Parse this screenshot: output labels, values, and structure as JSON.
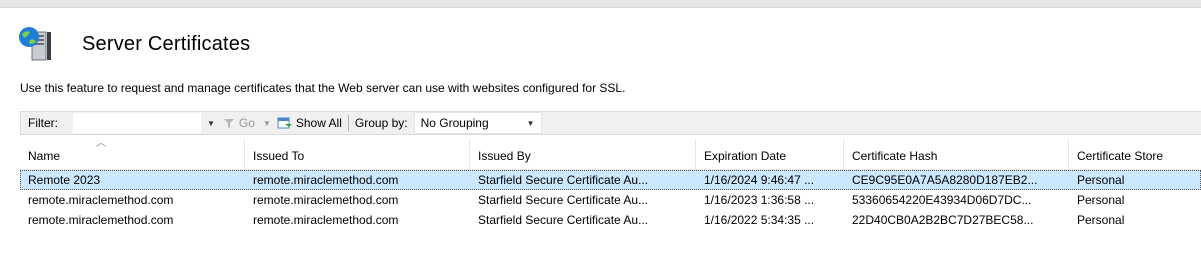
{
  "header": {
    "title": "Server Certificates",
    "description": "Use this feature to request and manage certificates that the Web server can use with websites configured for SSL."
  },
  "toolbar": {
    "filter_label": "Filter:",
    "filter_value": "",
    "go_label": "Go",
    "show_all_label": "Show All",
    "group_by_label": "Group by:",
    "group_by_value": "No Grouping"
  },
  "table": {
    "columns": [
      "Name",
      "Issued To",
      "Issued By",
      "Expiration Date",
      "Certificate Hash",
      "Certificate Store"
    ],
    "sorted_column": "Name",
    "rows": [
      [
        "Remote 2023",
        "remote.miraclemethod.com",
        "Starfield Secure Certificate Au...",
        "1/16/2024 9:46:47 ...",
        "CE9C95E0A7A5A8280D187EB2...",
        "Personal"
      ],
      [
        "remote.miraclemethod.com",
        "remote.miraclemethod.com",
        "Starfield Secure Certificate Au...",
        "1/16/2023 1:36:58 ...",
        "53360654220E43934D06D7DC...",
        "Personal"
      ],
      [
        "remote.miraclemethod.com",
        "remote.miraclemethod.com",
        "Starfield Secure Certificate Au...",
        "1/16/2022 5:34:35 ...",
        "22D40CB0A2B2BC7D27BEC58...",
        "Personal"
      ]
    ],
    "selected_row_index": 0
  },
  "colors": {
    "selection": "#cce8ff",
    "toolbar_bg": "#f0f0f0"
  },
  "icons": [
    "server-certificates-icon",
    "go-icon",
    "show-all-icon",
    "dropdown-caret-icon",
    "sort-ascending-icon"
  ]
}
